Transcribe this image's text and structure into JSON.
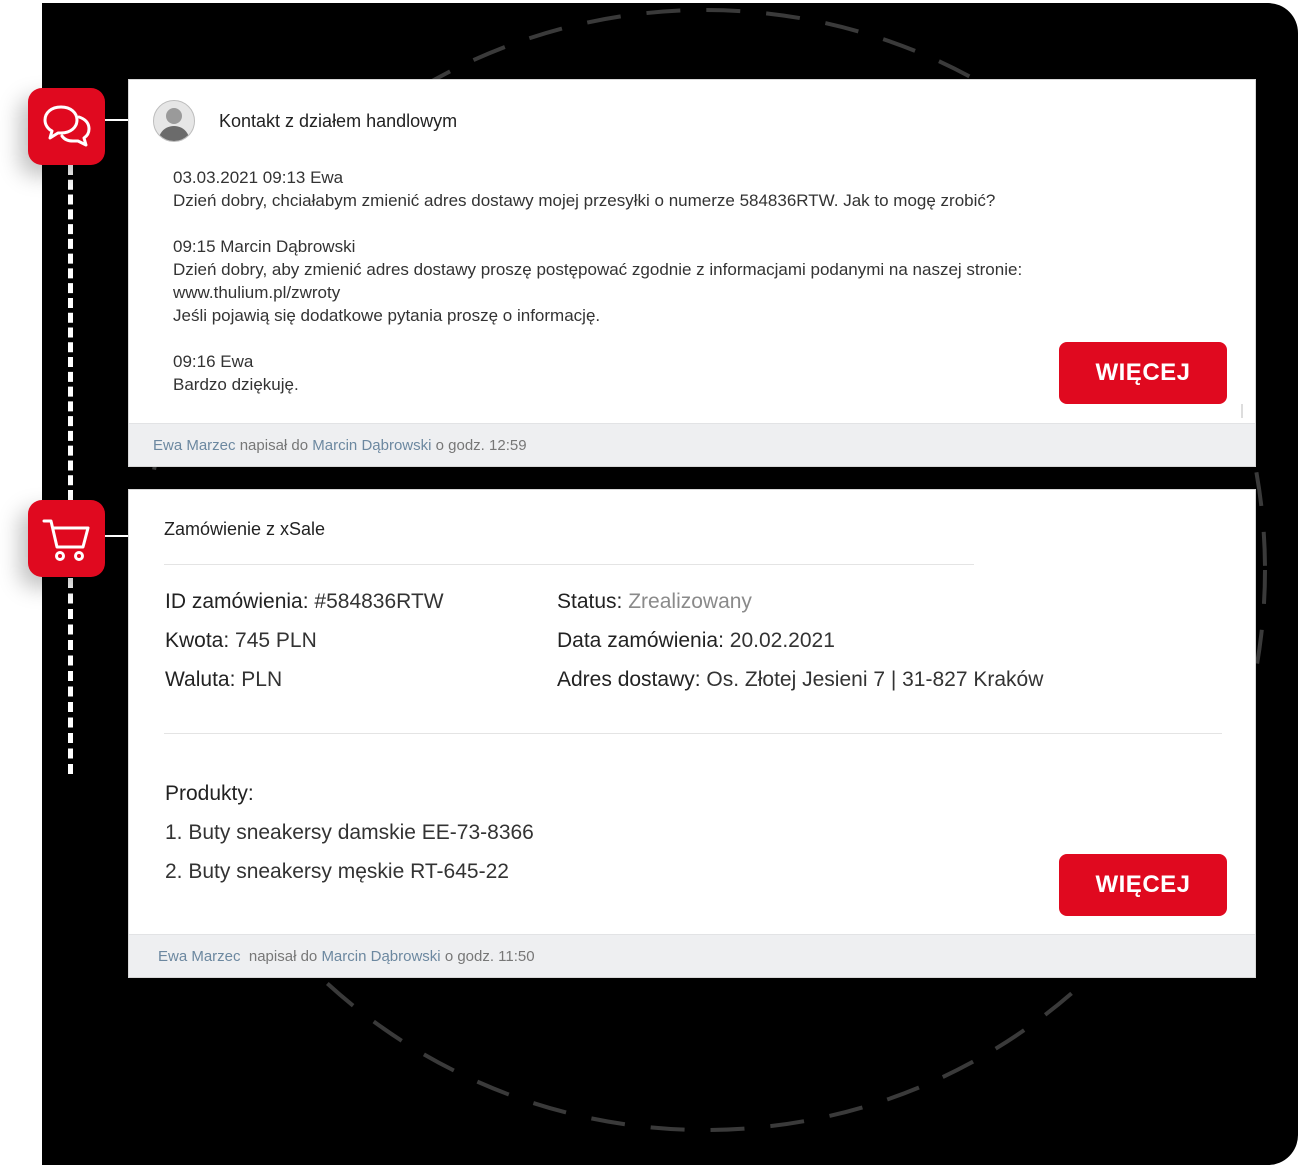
{
  "chat_card": {
    "title": "Kontakt z działem handlowym",
    "messages": [
      {
        "header": "03.03.2021  09:13 Ewa",
        "lines": [
          "Dzień dobry, chciałabym zmienić adres dostawy mojej przesyłki o numerze 584836RTW. Jak to mogę zrobić?"
        ]
      },
      {
        "header": "09:15 Marcin Dąbrowski",
        "lines": [
          "Dzień dobry, aby zmienić adres dostawy proszę postępować zgodnie z informacjami podanymi na naszej stronie:",
          "www.thulium.pl/zwroty",
          "Jeśli pojawią się dodatkowe pytania proszę o informację."
        ]
      },
      {
        "header": "09:16 Ewa",
        "lines": [
          "Bardzo dziękuję."
        ]
      }
    ],
    "more_label": "WIĘCEJ",
    "footer": {
      "author": "Ewa Marzec",
      "verb": "napisał do",
      "recipient": "Marcin Dąbrowski",
      "time": "o godz. 12:59"
    }
  },
  "order_card": {
    "title": "Zamówienie z xSale",
    "fields": {
      "id_label": "ID zamówienia:",
      "id_value": "#584836RTW",
      "amount_label": "Kwota:",
      "amount_value": "745 PLN",
      "currency_label": "Waluta:",
      "currency_value": "PLN",
      "status_label": "Status:",
      "status_value": "Zrealizowany",
      "date_label": "Data zamówienia:",
      "date_value": "20.02.2021",
      "address_label": "Adres dostawy:",
      "address_value": "Os. Złotej Jesieni 7 | 31-827 Kraków"
    },
    "products_title": "Produkty:",
    "products": [
      "1. Buty sneakersy damskie EE-73-8366",
      "2. Buty sneakersy męskie RT-645-22"
    ],
    "more_label": "WIĘCEJ",
    "footer": {
      "author": "Ewa Marzec",
      "verb": "napisał do",
      "recipient": "Marcin Dąbrowski",
      "time": "o godz. 11:50"
    }
  },
  "icons": {
    "chat": "chat-bubbles-icon",
    "order": "shopping-cart-icon",
    "avatar": "user-avatar"
  },
  "colors": {
    "accent": "#e0091f",
    "link": "#6c88a0",
    "status": "#8a8a8a",
    "background": "#000000"
  }
}
